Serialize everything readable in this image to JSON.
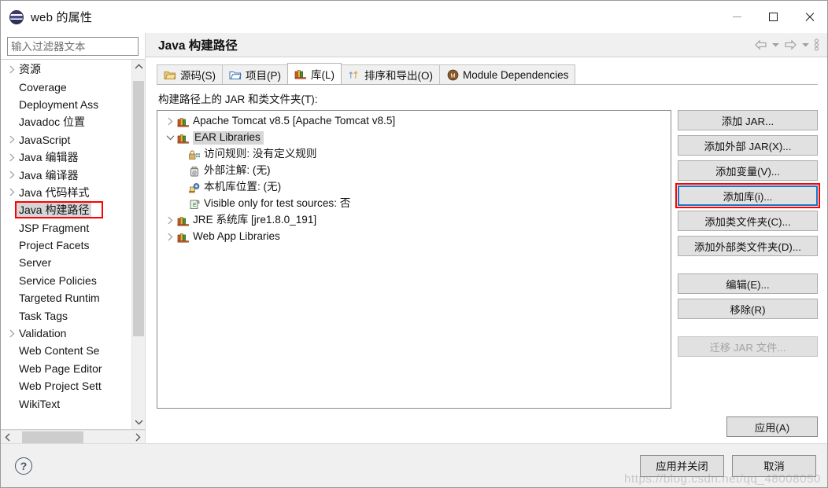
{
  "window": {
    "title": "web 的属性",
    "app_icon": "eclipse-icon",
    "minimize_label": "最小化",
    "maximize_label": "最大化",
    "close_label": "关闭"
  },
  "sidebar": {
    "filter_placeholder": "输入过滤器文本",
    "filter_value": "",
    "items": [
      {
        "label": "资源",
        "expandable": true,
        "selected": false
      },
      {
        "label": "Coverage",
        "expandable": false,
        "selected": false
      },
      {
        "label": "Deployment Ass",
        "expandable": false,
        "selected": false
      },
      {
        "label": "Javadoc 位置",
        "expandable": false,
        "selected": false
      },
      {
        "label": "JavaScript",
        "expandable": true,
        "selected": false
      },
      {
        "label": "Java 编辑器",
        "expandable": true,
        "selected": false
      },
      {
        "label": "Java 编译器",
        "expandable": true,
        "selected": false
      },
      {
        "label": "Java 代码样式",
        "expandable": true,
        "selected": false
      },
      {
        "label": "Java 构建路径",
        "expandable": false,
        "selected": true
      },
      {
        "label": "JSP Fragment",
        "expandable": false,
        "selected": false
      },
      {
        "label": "Project Facets",
        "expandable": false,
        "selected": false
      },
      {
        "label": "Server",
        "expandable": false,
        "selected": false
      },
      {
        "label": "Service Policies",
        "expandable": false,
        "selected": false
      },
      {
        "label": "Targeted Runtim",
        "expandable": false,
        "selected": false
      },
      {
        "label": "Task Tags",
        "expandable": false,
        "selected": false
      },
      {
        "label": "Validation",
        "expandable": true,
        "selected": false
      },
      {
        "label": "Web Content Se",
        "expandable": false,
        "selected": false
      },
      {
        "label": "Web Page Editor",
        "expandable": false,
        "selected": false
      },
      {
        "label": "Web Project Sett",
        "expandable": false,
        "selected": false
      },
      {
        "label": "WikiText",
        "expandable": false,
        "selected": false
      }
    ]
  },
  "page": {
    "title": "Java 构建路径",
    "nav": {
      "back_icon": "back-arrow-icon",
      "back_dropdown_icon": "chevron-down-icon",
      "forward_icon": "forward-arrow-icon",
      "forward_dropdown_icon": "chevron-down-icon",
      "menu_icon": "vertical-dots-menu-icon"
    },
    "tabs": [
      {
        "label": "源码(S)",
        "icon": "source-folder-icon",
        "active": false
      },
      {
        "label": "项目(P)",
        "icon": "project-folder-icon",
        "active": false
      },
      {
        "label": "库(L)",
        "icon": "library-books-icon",
        "active": true
      },
      {
        "label": "排序和导出(O)",
        "icon": "order-export-arrows-icon",
        "active": false
      },
      {
        "label": "Module Dependencies",
        "icon": "module-circle-icon",
        "active": false
      }
    ],
    "section_label": "构建路径上的 JAR 和类文件夹(T):",
    "classpath_tree": [
      {
        "label": "Apache Tomcat v8.5 [Apache Tomcat v8.5]",
        "icon": "library-books-icon",
        "arrow": "collapsed",
        "indent": 0,
        "selected": false
      },
      {
        "label": "EAR Libraries",
        "icon": "library-books-icon",
        "arrow": "expanded",
        "indent": 0,
        "selected": true
      },
      {
        "label": "访问规则: 没有定义规则",
        "icon": "access-rules-icon",
        "arrow": "none",
        "indent": 1,
        "selected": false
      },
      {
        "label": "外部注解:    (无)",
        "icon": "external-annotation-icon",
        "arrow": "none",
        "indent": 1,
        "selected": false
      },
      {
        "label": "本机库位置:    (无)",
        "icon": "native-library-icon",
        "arrow": "none",
        "indent": 1,
        "selected": false
      },
      {
        "label": "Visible only for test sources: 否",
        "icon": "test-visibility-icon",
        "arrow": "none",
        "indent": 1,
        "selected": false
      },
      {
        "label": "JRE 系统库 [jre1.8.0_191]",
        "icon": "library-books-icon",
        "arrow": "collapsed",
        "indent": 0,
        "selected": false
      },
      {
        "label": "Web App Libraries",
        "icon": "library-books-icon",
        "arrow": "collapsed",
        "indent": 0,
        "selected": false
      }
    ],
    "side_buttons": [
      {
        "label": "添加 JAR...",
        "disabled": false,
        "focused": false,
        "gap_after": false
      },
      {
        "label": "添加外部 JAR(X)...",
        "disabled": false,
        "focused": false,
        "gap_after": false
      },
      {
        "label": "添加变量(V)...",
        "disabled": false,
        "focused": false,
        "gap_after": false
      },
      {
        "label": "添加库(i)...",
        "disabled": false,
        "focused": true,
        "gap_after": false
      },
      {
        "label": "添加类文件夹(C)...",
        "disabled": false,
        "focused": false,
        "gap_after": false
      },
      {
        "label": "添加外部类文件夹(D)...",
        "disabled": false,
        "focused": false,
        "gap_after": true
      },
      {
        "label": "编辑(E)...",
        "disabled": false,
        "focused": false,
        "gap_after": false
      },
      {
        "label": "移除(R)",
        "disabled": false,
        "focused": false,
        "gap_after": true
      },
      {
        "label": "迁移 JAR 文件...",
        "disabled": true,
        "focused": false,
        "gap_after": false
      }
    ],
    "apply_label": "应用(A)"
  },
  "footer": {
    "help_label": "?",
    "apply_and_close_label": "应用并关闭",
    "cancel_label": "取消"
  },
  "watermark": "https://blog.csdn.net/qq_48008050",
  "colors": {
    "accent": "#0078d7",
    "highlight_red": "#ff0000",
    "focus_blue": "#1477c8",
    "selection_gray": "#d6d6d6",
    "button_face": "#e1e1e1"
  }
}
